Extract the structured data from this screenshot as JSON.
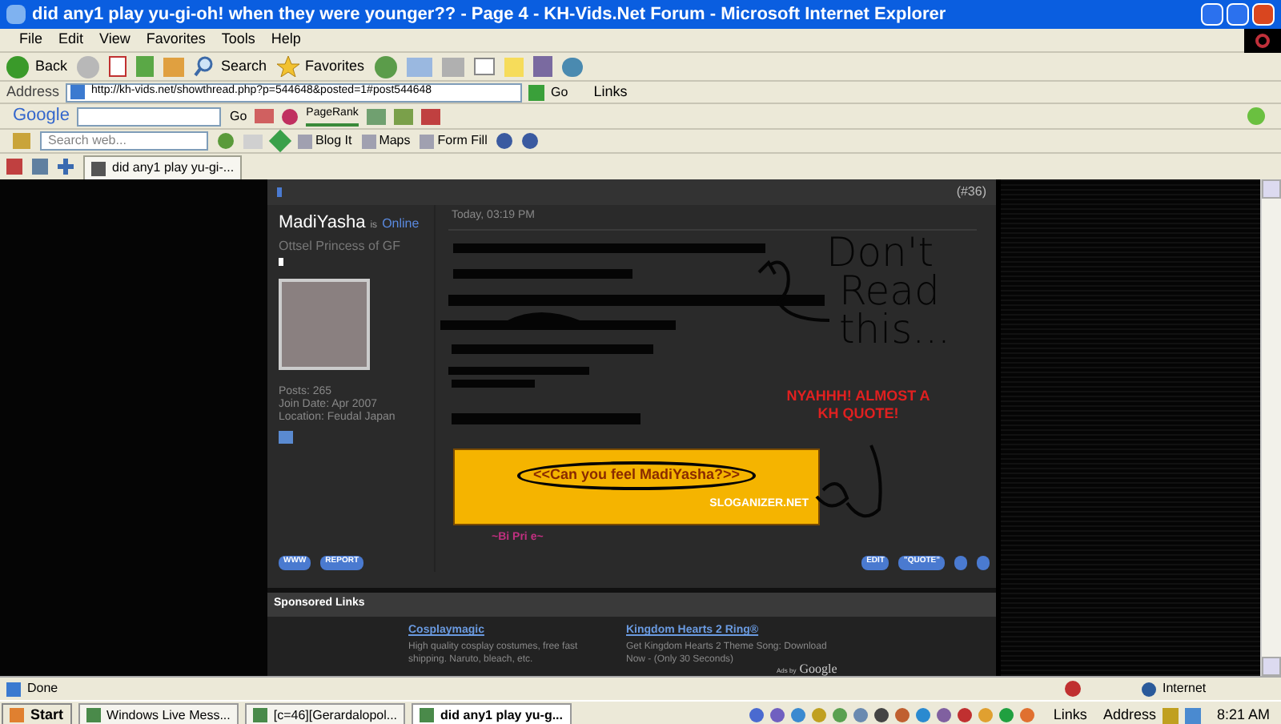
{
  "window": {
    "title": "did any1 play yu-gi-oh! when they were younger?? - Page 4 - KH-Vids.Net Forum - Microsoft Internet Explorer"
  },
  "menu": [
    "File",
    "Edit",
    "View",
    "Favorites",
    "Tools",
    "Help"
  ],
  "toolbar": {
    "back": "Back",
    "search": "Search",
    "favorites": "Favorites"
  },
  "address": {
    "label": "Address",
    "url": "http://kh-vids.net/showthread.php?p=544648&posted=1#post544648",
    "go": "Go",
    "links": "Links"
  },
  "google_bar": {
    "logo": "Google",
    "go": "Go",
    "pagerank": "PageRank"
  },
  "links_bar": {
    "placeholder": "Search web...",
    "items": [
      "Blog It",
      "Maps",
      "Form Fill"
    ]
  },
  "tabs": [
    {
      "label": "did any1 play yu-gi-...",
      "selected": true
    }
  ],
  "post": {
    "number": "(#36)",
    "author": "MadiYasha",
    "status_prefix": "is",
    "status": "Online",
    "user_title": "Ottsel Princess of GF",
    "date": "Today, 03:19 PM",
    "stats": [
      "Posts: 265",
      "Join Date: Apr 2007",
      "Location: Feudal Japan"
    ],
    "scribble_text": [
      "Don't",
      "Read",
      "this..."
    ],
    "red_text": "NYAHHH! ALMOST A KH QUOTE!",
    "banner": {
      "slogan": "<<Can you feel MadiYasha?>>",
      "site": "SLOGANIZER.NET"
    },
    "signature_line": "~Bi Pri e~",
    "left_buttons": [
      "WWW",
      "REPORT"
    ],
    "right_buttons": [
      "EDIT",
      "\"QUOTE\""
    ]
  },
  "sponsored": {
    "title": "Sponsored Links",
    "ads": [
      {
        "title": "Cosplaymagic",
        "text": "High quality cosplay costumes, free fast shipping. Naruto, bleach, etc."
      },
      {
        "title": "Kingdom Hearts 2 Ring®",
        "text": "Get Kingdom Hearts 2 Theme Song: Download Now - (Only 30 Seconds)"
      }
    ],
    "ads_by": "Ads by",
    "ads_brand": "Google"
  },
  "status_bar": {
    "text": "Done",
    "zone": "Internet"
  },
  "taskbar": {
    "start": "Start",
    "tasks": [
      {
        "label": "Windows Live Mess...",
        "selected": false
      },
      {
        "label": "[c=46][Gerardalopol...",
        "selected": false
      },
      {
        "label": "did any1 play yu-g...",
        "selected": true
      }
    ],
    "links": "Links",
    "address": "Address",
    "clock": "8:21 AM"
  }
}
